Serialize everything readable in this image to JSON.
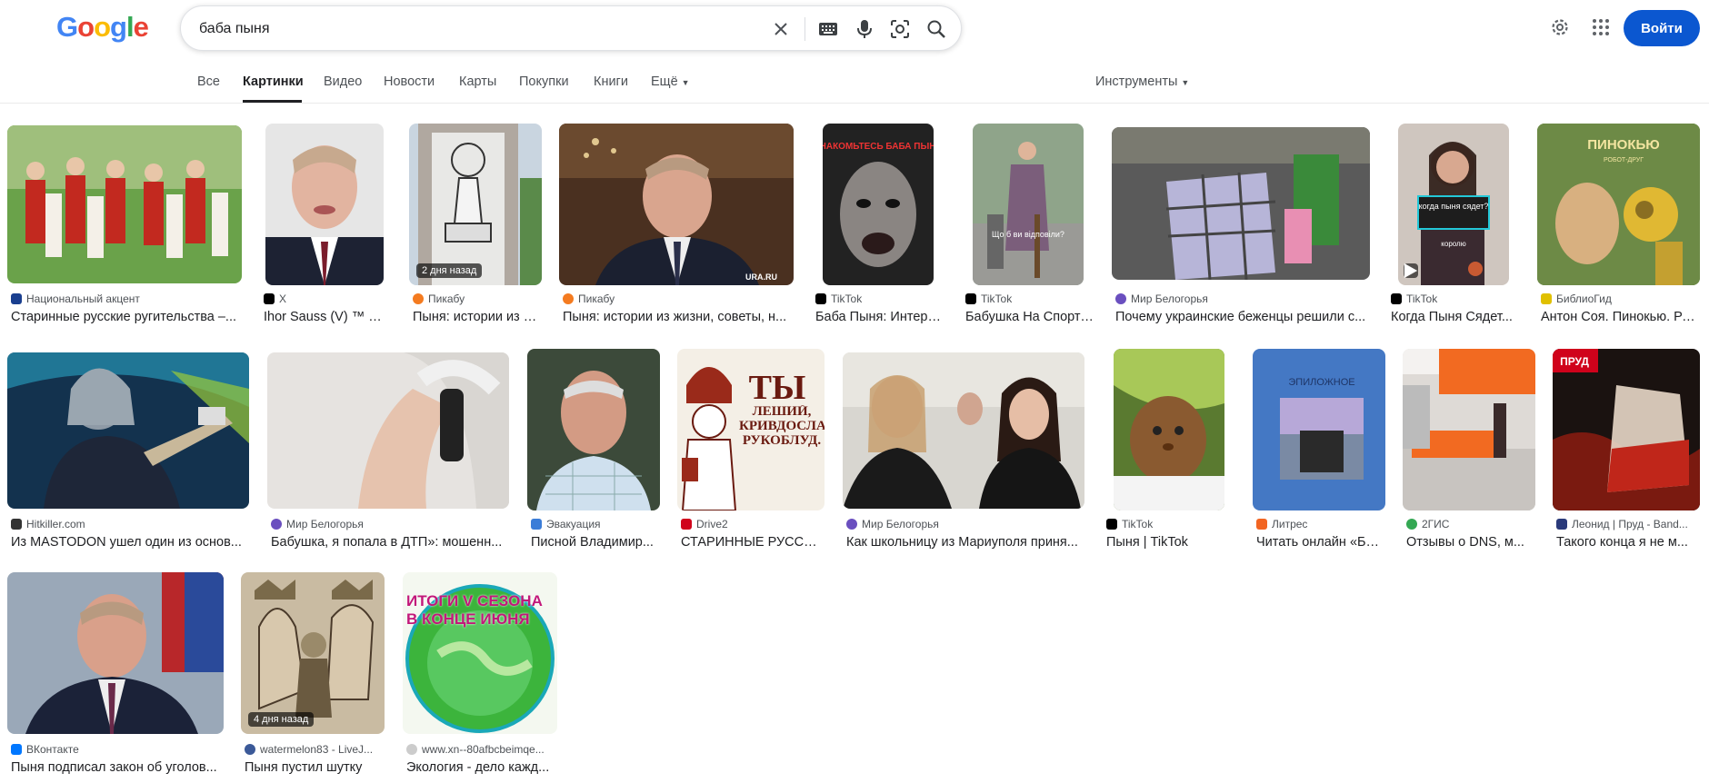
{
  "search": {
    "query": "баба пыня"
  },
  "header": {
    "signin_label": "Войти"
  },
  "tabs": [
    {
      "label": "Все"
    },
    {
      "label": "Картинки"
    },
    {
      "label": "Видео"
    },
    {
      "label": "Новости"
    },
    {
      "label": "Карты"
    },
    {
      "label": "Покупки"
    },
    {
      "label": "Книги"
    },
    {
      "label": "Ещё"
    }
  ],
  "tools_label": "Инструменты",
  "results": [
    {
      "source": "Национальный акцент",
      "title": "Старинные русские ругительства –...",
      "favicon_color": "#1a3f8f"
    },
    {
      "source": "X",
      "title": "Ihor Sauss (V) ™ on X: \"Ш...",
      "favicon_color": "#000000"
    },
    {
      "source": "Пикабу",
      "title": "Пыня: истории из жизни...",
      "tag": "2 дня назад",
      "favicon_color": "#f47b20"
    },
    {
      "source": "Пикабу",
      "title": "Пыня: истории из жизни, советы, н...",
      "favicon_color": "#f47b20"
    },
    {
      "source": "TikTok",
      "title": "Баба Пыня: Интервью...",
      "favicon_color": "#000000"
    },
    {
      "source": "TikTok",
      "title": "Бабушка На Спорте...",
      "favicon_color": "#000000"
    },
    {
      "source": "Мир Белогорья",
      "title": "Почему украинские беженцы решили с...",
      "favicon_color": "#6a4fbf"
    },
    {
      "source": "TikTok",
      "title": "Когда Пыня Сядет...",
      "favicon_color": "#000000"
    },
    {
      "source": "БиблиоГид",
      "title": "Антон Соя. Пинокью. Ро...",
      "favicon_color": "#e0c000"
    },
    {
      "source": "Hitkiller.com",
      "title": "Из MASTODON ушел один из основ...",
      "favicon_color": "#333333"
    },
    {
      "source": "Мир Белогорья",
      "title": "Бабушка, я попала в ДТП»: мошенн...",
      "favicon_color": "#6a4fbf"
    },
    {
      "source": "Эвакуация",
      "title": "Писной Владимир...",
      "favicon_color": "#3b7dd8"
    },
    {
      "source": "Drive2",
      "title": "СТАРИННЫЕ РУССКИЕ...",
      "favicon_color": "#d0021b"
    },
    {
      "source": "Мир Белогорья",
      "title": "Как школьницу из Мариуполя приня...",
      "favicon_color": "#6a4fbf"
    },
    {
      "source": "TikTok",
      "title": "Пыня | TikTok",
      "favicon_color": "#000000"
    },
    {
      "source": "Литрес",
      "title": "Читать онлайн «Бабушка...",
      "favicon_color": "#f26522"
    },
    {
      "source": "2ГИС",
      "title": "Отзывы о DNS, м...",
      "favicon_color": "#34a853"
    },
    {
      "source": "Леонид | Пруд - Band...",
      "title": "Такого конца я не м...",
      "favicon_color": "#2a3a7a"
    },
    {
      "source": "ВКонтакте",
      "title": "Пыня подписал закон об уголов...",
      "favicon_color": "#0077ff"
    },
    {
      "source": "watermelon83 - LiveJ...",
      "title": "Пыня пустил шутку",
      "tag": "4 дня назад",
      "favicon_color": "#3b5998"
    },
    {
      "source": "www.xn--80afbcbeimqe...",
      "title": "Экология - дело кажд...",
      "favicon_color": "#aaaaaa"
    }
  ],
  "thumb_text": {
    "tiktok1": "ЗНАКОМЬТЕСЬ БАБА ПЫНЯ",
    "tiktok2": "Що б ви відповіли?",
    "tiktok3_a": "когда пыня сядет?",
    "tiktok3_b": "королю",
    "book": "ПИНОКЬЮ",
    "book_sub": "РОБОТ-ДРУГ",
    "drive2_big": "ТЫ",
    "drive2_small": "ЛЕШИЙ, КРИВДОСЛАВ РУКОБЛУД.",
    "litres": "ЭПИЛОЖНОЕ",
    "prud": "ПРУД",
    "ecology": "ИТОГИ V СЕЗОНА В КОНЦЕ ИЮНЯ",
    "ura": "URA.RU"
  }
}
